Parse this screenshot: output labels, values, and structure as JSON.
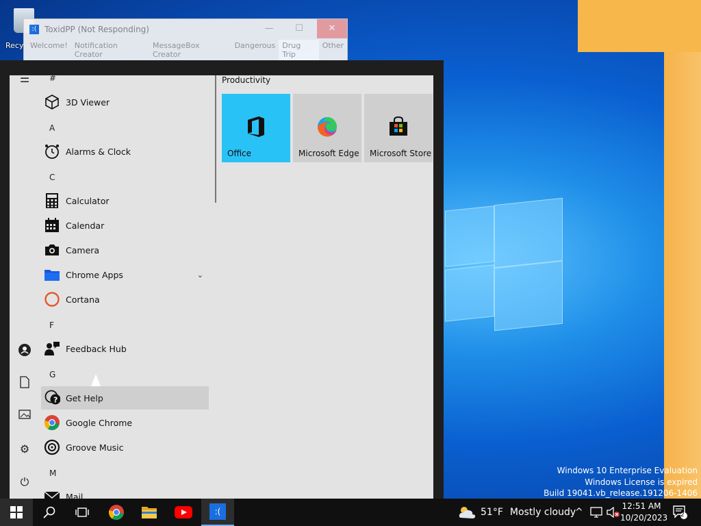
{
  "desktop": {
    "recycle_label": "Recy",
    "watermark": {
      "line1": "Windows 10 Enterprise Evaluation",
      "line2": "Windows License is expired",
      "line3": "Build 19041.vb_release.191206-1406"
    }
  },
  "toxid_window": {
    "title": "ToxidPP (Not Responding)",
    "icon_glyph": ":(",
    "min_glyph": "—",
    "max_glyph": "☐",
    "close_glyph": "✕",
    "tabs": [
      "Welcome!",
      "Notification Creator",
      "MessageBox Creator",
      "Dangerous",
      "Drug Trip",
      "Other"
    ]
  },
  "start_menu": {
    "headers": {
      "hash": "#",
      "a": "A",
      "c": "C",
      "f": "F",
      "g": "G",
      "m": "M"
    },
    "apps": {
      "viewer3d": "3D Viewer",
      "alarms": "Alarms & Clock",
      "calculator": "Calculator",
      "calendar": "Calendar",
      "camera": "Camera",
      "chrome_apps": "Chrome Apps",
      "cortana": "Cortana",
      "feedback": "Feedback Hub",
      "get_help": "Get Help",
      "google_chrome": "Google Chrome",
      "groove": "Groove Music",
      "mail": "Mail"
    },
    "tile_group": "Productivity",
    "tiles": {
      "office": "Office",
      "edge": "Microsoft Edge",
      "store": "Microsoft Store"
    }
  },
  "taskbar": {
    "weather_temp": "51°F",
    "weather_desc": "Mostly cloudy",
    "time": "12:51 AM",
    "date": "10/20/2023",
    "notification_count": "2",
    "app_glyph": ":("
  },
  "colors": {
    "office_tile": "#29c2f7",
    "taskbar": "#101010",
    "start_bg": "#e3e3e3"
  }
}
